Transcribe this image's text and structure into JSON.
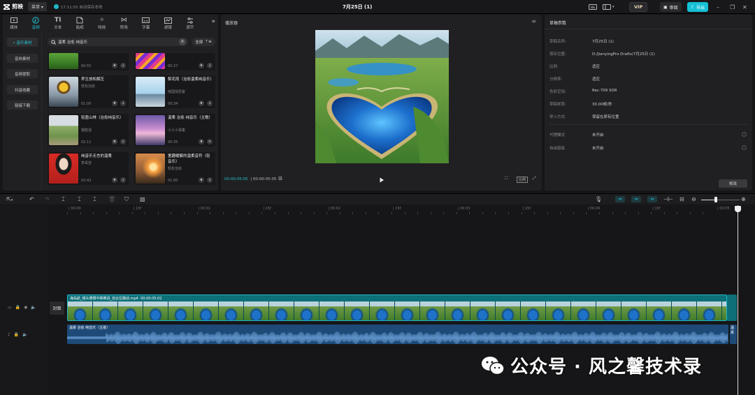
{
  "titlebar": {
    "app_name": "剪映",
    "menu_label": "菜单",
    "autosave_text": "17:11:55 自动保存本地",
    "window_title": "7月25日 (1)",
    "vip_label": "VIP",
    "review_label": "审阅",
    "export_label": "导出"
  },
  "media_tabs": [
    {
      "label": "媒体",
      "icon": "media-icon"
    },
    {
      "label": "音频",
      "icon": "audio-icon",
      "active": true
    },
    {
      "label": "文本",
      "icon": "text-icon"
    },
    {
      "label": "贴纸",
      "icon": "sticker-icon"
    },
    {
      "label": "特效",
      "icon": "effects-icon"
    },
    {
      "label": "转场",
      "icon": "transition-icon"
    },
    {
      "label": "字幕",
      "icon": "subtitle-icon"
    },
    {
      "label": "滤镜",
      "icon": "filter-icon"
    },
    {
      "label": "调节",
      "icon": "adjust-icon"
    }
  ],
  "sidebar": [
    "• 音乐素材",
    "音效素材",
    "音频提取",
    "抖音收藏",
    "链接下载"
  ],
  "search": {
    "query": "温柔 治愈 纯音乐",
    "filter_label": "全部"
  },
  "cards": [
    {
      "title": "",
      "author": "",
      "duration": "00:55"
    },
    {
      "title": "",
      "author": "",
      "duration": "00:27"
    },
    {
      "title": "养生放松解压",
      "author": "轻松治愈",
      "duration": "01:00"
    },
    {
      "title": "梨花雨（治愈温柔纯音乐）",
      "author": "南国情思客",
      "duration": "00:34"
    },
    {
      "title": "轻盈山林（治愈纯音乐）",
      "author": "银胜强",
      "duration": "02:11"
    },
    {
      "title": "温柔 治愈 纯音乐（主歌）",
      "author": "小小小事集",
      "duration": "00:35"
    },
    {
      "title": "纯音乐无言的温柔",
      "author": "李哥芸",
      "duration": "02:42"
    },
    {
      "title": "童趣暖解的温柔音符（轻音乐）",
      "author": "轻松治愈",
      "duration": "01:00"
    }
  ],
  "player": {
    "title": "播放器",
    "current_time": "00:00:05:05",
    "total_time": "00:00:05:05",
    "ratio_label": "比例"
  },
  "params": {
    "title": "草稿参数",
    "rows": [
      {
        "label": "草稿名称:",
        "value": "7月25日 (1)"
      },
      {
        "label": "保存位置:",
        "value": "D:/JianyingPro Drafts/7月25日 (1)"
      },
      {
        "label": "比例:",
        "value": "适应"
      },
      {
        "label": "分辨率:",
        "value": "适应"
      },
      {
        "label": "色彩空间:",
        "value": "Rec.709 SDR"
      },
      {
        "label": "草稿帧率:",
        "value": "30.00帧/秒"
      },
      {
        "label": "导入方式:",
        "value": "保留在原有位置"
      }
    ],
    "rows2": [
      {
        "label": "代理模式",
        "value": "未开启"
      },
      {
        "label": "自由层级",
        "value": "未开启"
      }
    ],
    "edit_label": "修改"
  },
  "ruler": [
    "00:00",
    "15f",
    "00:01",
    "15f",
    "00:02",
    "15f",
    "00:03",
    "15f",
    "00:04",
    "15f",
    "00:05"
  ],
  "timeline": {
    "cover_label": "封面",
    "video_clip_name": "海岛航_镜头慢慢平移推进_自云在飘动.mp4",
    "video_clip_duration": "00:00:05:02",
    "audio_clip_name": "温柔 治愈 纯音乐（主歌）",
    "audio_clip_short": "温柔"
  },
  "watermark": "公众号 · 风之馨技术录",
  "colors": {
    "accent": "#1fc2d4",
    "video_clip": "#0d6f77",
    "audio_clip": "#1e4a78"
  }
}
